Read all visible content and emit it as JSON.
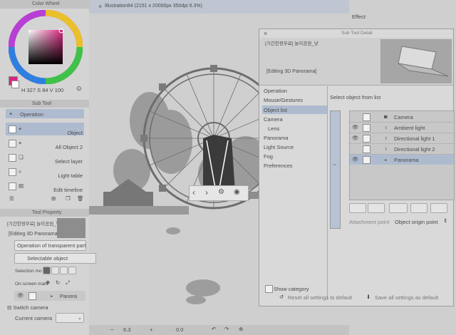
{
  "colors": {
    "accent_pink": "#d8277f",
    "selection": "#aebbcf",
    "ui_gray": "#d4d4d4",
    "canvas": "#cfcfcf"
  },
  "color_wheel": {
    "title": "Color Wheel",
    "readout": {
      "h": "327",
      "s": "84",
      "v": "100"
    }
  },
  "subtool": {
    "title": "Sub Tool",
    "group": "Operation",
    "items": [
      {
        "label": "Object",
        "icon": "object-arrow-icon",
        "selected": true
      },
      {
        "label": "All Object 2",
        "icon": "all-object-icon"
      },
      {
        "label": "Select layer",
        "icon": "select-layer-icon"
      },
      {
        "label": "Light table",
        "icon": "light-table-icon"
      },
      {
        "label": "Edit timeline",
        "icon": "timeline-icon"
      }
    ]
  },
  "tool_property": {
    "title": "Tool Property",
    "layer_name": "[기간한정무료] 놀이공원_낮",
    "mode_badge": "[Editing 3D Panorama]",
    "transparent_select": "Operation of transparent part",
    "object_select": "Selectable object",
    "selection_mode_label": "Selection mo",
    "onscreen_label": "On-screen mani",
    "panorama_value": "Panora",
    "switch_camera": "Switch camera",
    "current_camera": "Current camera"
  },
  "canvas": {
    "tab_title": "Illustration84 (2151 x 20000px 350dpi 6.3%)",
    "zoom": "6.3",
    "rotation": "0.0"
  },
  "effect_panel": {
    "title": "Effect"
  },
  "subtool_detail": {
    "title": "Sub Tool Detail",
    "layer_name": "[기간한정무료] 놀이공원_낮",
    "mode_badge": "[Editing 3D Panorama]",
    "categories": [
      "Operation",
      "Mouse/Gestures",
      "Object list",
      "Camera",
      "Lens",
      "Panorama",
      "Light Source",
      "Fog",
      "Preferences"
    ],
    "selected_category": "Object list",
    "list_title": "Select object from list",
    "objects": [
      {
        "label": "Camera",
        "icon": "camera-icon",
        "eye": false,
        "selected": false
      },
      {
        "label": "Ambient light",
        "icon": "bulb-icon",
        "eye": true,
        "selected": false
      },
      {
        "label": "Directional light 1",
        "icon": "bulb-icon",
        "eye": true,
        "selected": false
      },
      {
        "label": "Directional light 2",
        "icon": "bulb-icon",
        "eye": false,
        "selected": false
      },
      {
        "label": "Panorama",
        "icon": "panorama-icon",
        "eye": true,
        "selected": true
      }
    ],
    "attach_point": "Attachment point",
    "origin_point": "Object origin point",
    "show_category": "Show category",
    "reset_all": "Reset all settings to default",
    "save_all": "Save all settings as default"
  }
}
